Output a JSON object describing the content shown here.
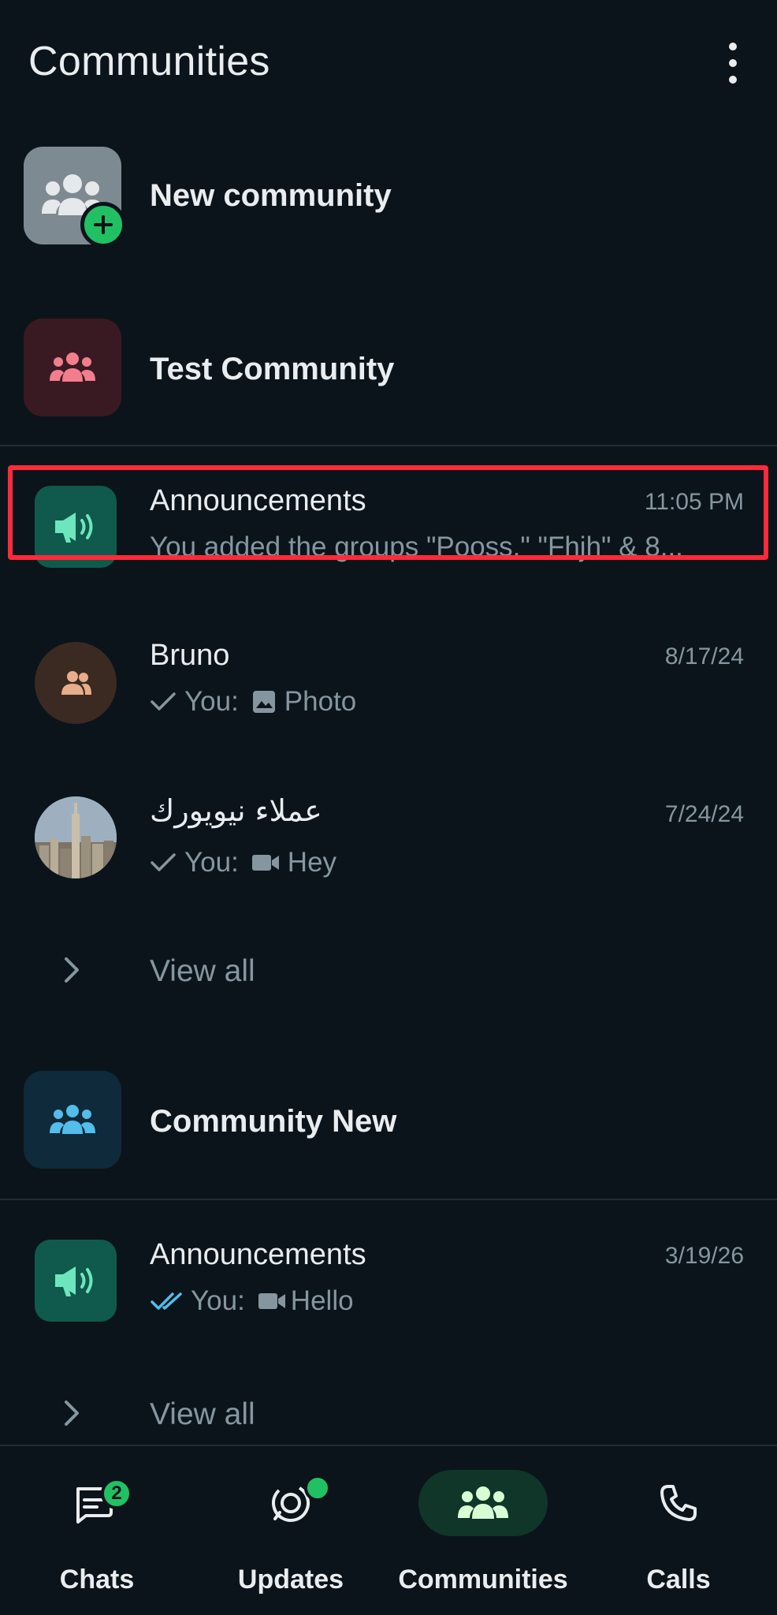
{
  "header": {
    "title": "Communities"
  },
  "new_community": {
    "label": "New community"
  },
  "communities": [
    {
      "name": "Test Community",
      "chats": [
        {
          "name": "Announcements",
          "time": "11:05 PM",
          "preview": "You added the groups \"Pooss,\" \"Fhjh\" & 8..."
        },
        {
          "name": "Bruno",
          "time": "8/17/24",
          "preview_prefix": "You:",
          "preview": "Photo"
        },
        {
          "name": "عملاء نيويورك",
          "time": "7/24/24",
          "preview_prefix": "You:",
          "preview": "Hey"
        }
      ],
      "view_all": "View all"
    },
    {
      "name": "Community New",
      "chats": [
        {
          "name": "Announcements",
          "time": "3/19/26",
          "preview_prefix": "You:",
          "preview": "Hello"
        }
      ],
      "view_all": "View all"
    }
  ],
  "nav": {
    "items": [
      {
        "label": "Chats",
        "badge": "2"
      },
      {
        "label": "Updates"
      },
      {
        "label": "Communities"
      },
      {
        "label": "Calls"
      }
    ]
  },
  "colors": {
    "background": "#0b141a",
    "accent": "#21c063",
    "highlight": "#ff2a3a",
    "announcement": "#0f5a4d",
    "read_tick": "#53bdeb"
  }
}
